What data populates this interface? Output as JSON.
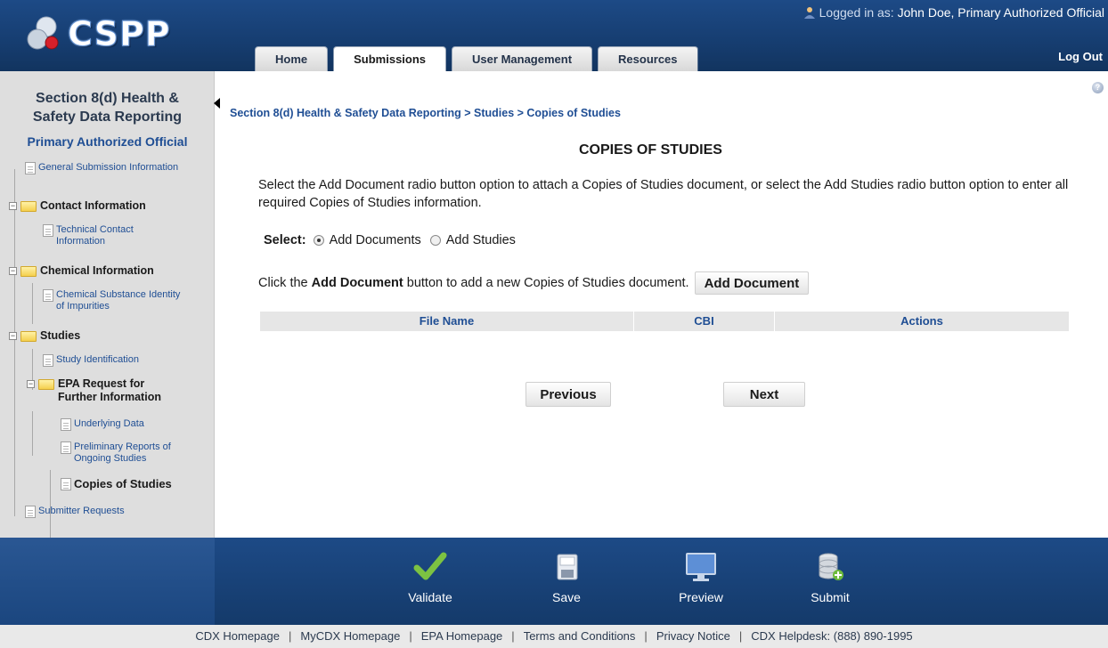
{
  "header": {
    "logo_text": "CSPP",
    "logged_in_prefix": "Logged in as:",
    "user_name": "John Doe, Primary Authorized Official",
    "logout": "Log Out",
    "tabs": [
      "Home",
      "Submissions",
      "User Management",
      "Resources"
    ],
    "active_tab": "Submissions"
  },
  "sidebar": {
    "title_line1": "Section 8(d) Health &",
    "title_line2": "Safety Data Reporting",
    "role": "Primary Authorized Official",
    "items": [
      {
        "label": "General Submission Information"
      },
      {
        "label": "Contact Information"
      },
      {
        "label": "Technical Contact Information"
      },
      {
        "label": "Chemical Information"
      },
      {
        "label": "Chemical Substance Identity of Impurities"
      },
      {
        "label": "Studies"
      },
      {
        "label": "Study Identification"
      },
      {
        "label": "EPA Request for Further Information"
      },
      {
        "label": "Underlying Data"
      },
      {
        "label": "Preliminary Reports of Ongoing Studies"
      },
      {
        "label": "Copies of Studies"
      },
      {
        "label": "Submitter Requests"
      }
    ]
  },
  "main": {
    "breadcrumb": "Section 8(d) Health & Safety Data Reporting > Studies > Copies of Studies",
    "title": "COPIES OF STUDIES",
    "instructions": "Select the Add Document radio button option to attach a Copies of Studies document, or select the Add Studies radio button option to enter all required Copies of Studies information.",
    "select_label": "Select:",
    "radio_options": [
      "Add Documents",
      "Add Studies"
    ],
    "selected_option": "Add Documents",
    "add_doc_text_pre": "Click the ",
    "add_doc_text_bold": "Add Document",
    "add_doc_text_post": " button to add a new Copies of Studies document.",
    "add_doc_button": "Add Document",
    "table_headers": [
      "File Name",
      "CBI",
      "Actions"
    ],
    "prev_button": "Previous",
    "next_button": "Next"
  },
  "footer": {
    "actions": [
      "Validate",
      "Save",
      "Preview",
      "Submit"
    ],
    "links": [
      "CDX Homepage",
      "MyCDX Homepage",
      "EPA Homepage",
      "Terms and Conditions",
      "Privacy Notice",
      "CDX Helpdesk: (888) 890-1995"
    ]
  },
  "colors": {
    "header_blue": "#1d4a86",
    "link_blue": "#1f4e94",
    "sidebar_bg": "#dedede",
    "validate_green": "#7cc242"
  }
}
